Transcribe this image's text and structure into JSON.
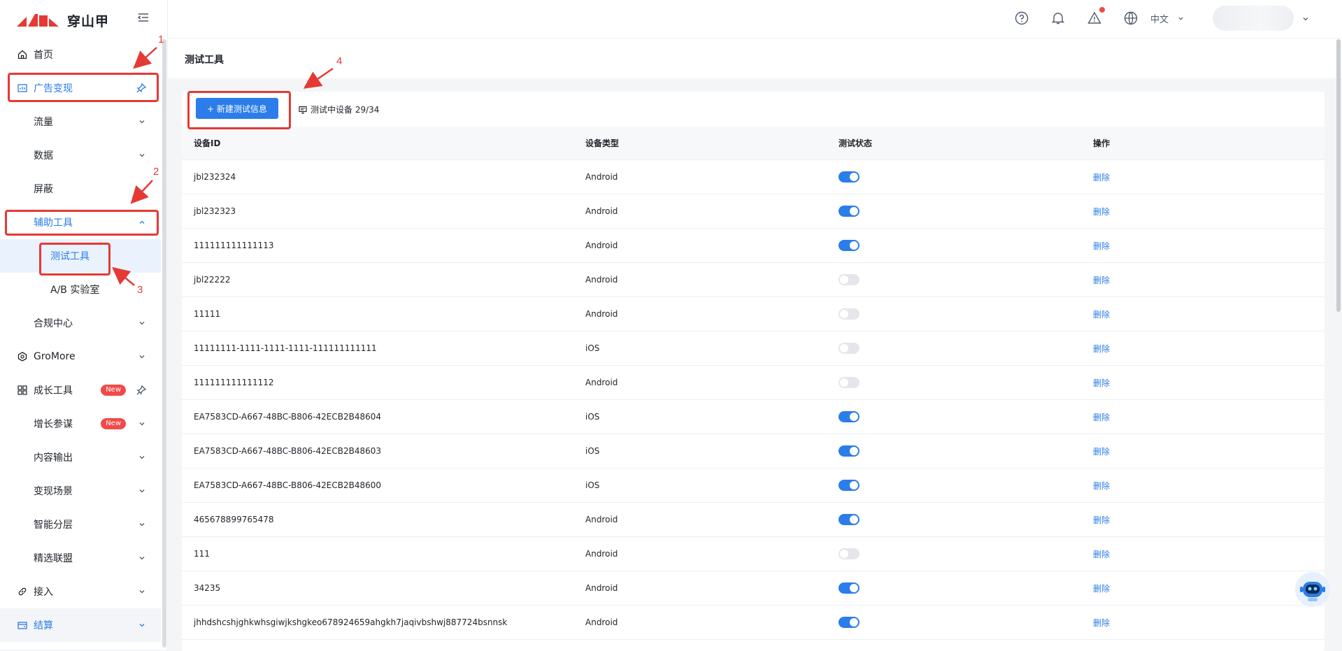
{
  "brand": {
    "name": "穿山甲",
    "accent": "#2b7de9",
    "logo_color": "#e53935"
  },
  "header": {
    "icons": [
      "help-icon",
      "bell-icon",
      "alert-icon",
      "globe-icon"
    ],
    "language": "中文"
  },
  "sidebar": {
    "items": [
      {
        "label": "首页",
        "icon": "home-icon"
      },
      {
        "label": "广告变现",
        "icon": "chart-icon"
      },
      {
        "label": "流量"
      },
      {
        "label": "数据"
      },
      {
        "label": "屏蔽"
      },
      {
        "label": "辅助工具"
      },
      {
        "label": "测试工具"
      },
      {
        "label": "A/B 实验室"
      },
      {
        "label": "合规中心"
      },
      {
        "label": "GroMore",
        "icon": "gromore-icon"
      },
      {
        "label": "成长工具",
        "icon": "grid-icon",
        "badge": "New"
      },
      {
        "label": "增长参谋",
        "badge": "New"
      },
      {
        "label": "内容输出"
      },
      {
        "label": "变现场景"
      },
      {
        "label": "智能分层"
      },
      {
        "label": "精选联盟"
      },
      {
        "label": "接入",
        "icon": "link-icon"
      },
      {
        "label": "结算",
        "icon": "wallet-icon"
      }
    ]
  },
  "page": {
    "title": "测试工具"
  },
  "toolbar": {
    "new_button": "+ 新建测试信息",
    "device_count": "测试中设备 29/34"
  },
  "table": {
    "headers": [
      "设备ID",
      "设备类型",
      "测试状态",
      "操作"
    ],
    "rows": [
      {
        "id": "jbl232324",
        "type": "Android",
        "on": true,
        "action": "删除"
      },
      {
        "id": "jbl232323",
        "type": "Android",
        "on": true,
        "action": "删除"
      },
      {
        "id": "111111111111113",
        "type": "Android",
        "on": true,
        "action": "删除"
      },
      {
        "id": "jbl22222",
        "type": "Android",
        "on": false,
        "action": "删除"
      },
      {
        "id": "11111",
        "type": "Android",
        "on": false,
        "action": "删除"
      },
      {
        "id": "11111111-1111-1111-1111-111111111111",
        "type": "iOS",
        "on": false,
        "action": "删除"
      },
      {
        "id": "111111111111112",
        "type": "Android",
        "on": false,
        "action": "删除"
      },
      {
        "id": "EA7583CD-A667-48BC-B806-42ECB2B48604",
        "type": "iOS",
        "on": true,
        "action": "删除"
      },
      {
        "id": "EA7583CD-A667-48BC-B806-42ECB2B48603",
        "type": "iOS",
        "on": true,
        "action": "删除"
      },
      {
        "id": "EA7583CD-A667-48BC-B806-42ECB2B48600",
        "type": "iOS",
        "on": true,
        "action": "删除"
      },
      {
        "id": "465678899765478",
        "type": "Android",
        "on": true,
        "action": "删除"
      },
      {
        "id": "111",
        "type": "Android",
        "on": false,
        "action": "删除"
      },
      {
        "id": "34235",
        "type": "Android",
        "on": true,
        "action": "删除"
      },
      {
        "id": "jhhdshcshjghkwhsgiwjkshgkeo678924659ahgkh7jaqivbshwj887724bsnnsk",
        "type": "Android",
        "on": true,
        "action": "删除"
      }
    ]
  },
  "annotations": [
    "1",
    "2",
    "3",
    "4"
  ]
}
